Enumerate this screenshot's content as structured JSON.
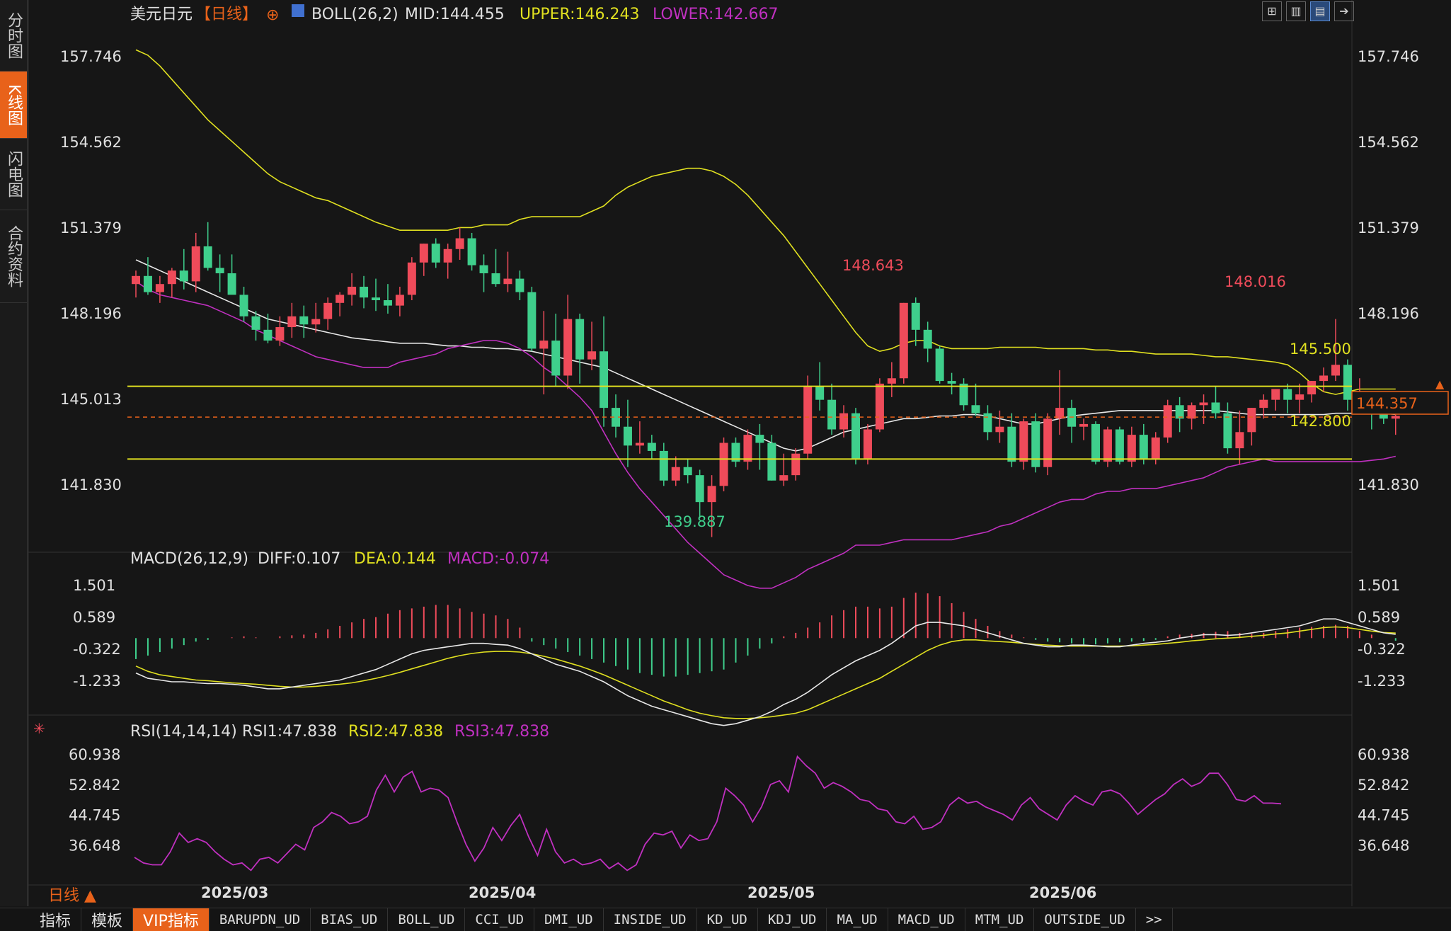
{
  "sidebar": {
    "items": [
      "分时图",
      "K线图",
      "闪电图",
      "合约资料"
    ],
    "active_index": 1
  },
  "header": {
    "symbol": "美元日元",
    "period": "【日线】",
    "boll_label": "BOLL(26,2)",
    "mid": "MID:144.455",
    "upper": "UPPER:146.243",
    "lower": "LOWER:142.667"
  },
  "toolbar_icons": [
    "grid-icon",
    "bar-chart-icon",
    "candle-chart-icon",
    "arrow-right-icon"
  ],
  "price_axis": {
    "ticks": [
      "157.746",
      "154.562",
      "151.379",
      "148.196",
      "145.013",
      "141.830"
    ],
    "current_price": "144.357",
    "current_price_value": 144.357
  },
  "annotations": {
    "high1": "148.643",
    "high2": "148.016",
    "low1": "139.887",
    "line_upper": "145.500",
    "line_lower": "142.800"
  },
  "macd": {
    "label": "MACD(26,12,9)",
    "diff": "DIFF:0.107",
    "dea": "DEA:0.144",
    "macd": "MACD:-0.074",
    "ticks": [
      "1.501",
      "0.589",
      "-0.322",
      "-1.233"
    ]
  },
  "rsi": {
    "label": "RSI(14,14,14)",
    "rsi1": "RSI1:47.838",
    "rsi2": "RSI2:47.838",
    "rsi3": "RSI3:47.838",
    "ticks": [
      "60.938",
      "52.842",
      "44.745",
      "36.648"
    ]
  },
  "date_labels": [
    "2025/03",
    "2025/04",
    "2025/05",
    "2025/06"
  ],
  "period_label": "日线 ▲",
  "bottom_tabs": [
    "指标",
    "模板",
    "VIP指标",
    "BARUPDN_UD",
    "BIAS_UD",
    "BOLL_UD",
    "CCI_UD",
    "DMI_UD",
    "INSIDE_UD",
    "KD_UD",
    "KDJ_UD",
    "MA_UD",
    "MACD_UD",
    "MTM_UD",
    "OUTSIDE_UD",
    ">>"
  ],
  "colors": {
    "up": "#ef4b5a",
    "down": "#3fcf8c",
    "mid": "#e8e8e8",
    "upper": "#e0e020",
    "lower": "#c030c0",
    "accent": "#e8621a"
  },
  "chart_data": {
    "type": "candlestick",
    "price_ylim": [
      139.6,
      158.8
    ],
    "macd_ylim": [
      -2.0,
      1.85
    ],
    "rsi_ylim": [
      28,
      64
    ],
    "ohlc": [
      [
        149.3,
        149.8,
        148.8,
        149.6
      ],
      [
        149.6,
        150.3,
        148.9,
        149.0
      ],
      [
        149.0,
        149.6,
        148.6,
        149.3
      ],
      [
        149.3,
        149.9,
        148.8,
        149.8
      ],
      [
        149.8,
        150.6,
        149.1,
        149.4
      ],
      [
        149.4,
        151.2,
        149.0,
        150.7
      ],
      [
        150.7,
        151.6,
        149.8,
        149.9
      ],
      [
        149.9,
        150.4,
        149.0,
        149.7
      ],
      [
        149.7,
        150.4,
        149.2,
        148.9
      ],
      [
        148.9,
        149.2,
        147.9,
        148.1
      ],
      [
        148.1,
        148.3,
        147.2,
        147.6
      ],
      [
        147.6,
        148.2,
        147.1,
        147.2
      ],
      [
        147.2,
        148.1,
        147.0,
        147.7
      ],
      [
        147.7,
        148.6,
        147.3,
        148.1
      ],
      [
        148.1,
        148.5,
        147.3,
        147.8
      ],
      [
        147.8,
        148.6,
        147.5,
        148.0
      ],
      [
        148.0,
        148.8,
        147.6,
        148.6
      ],
      [
        148.6,
        149.0,
        148.1,
        148.9
      ],
      [
        148.9,
        149.7,
        148.5,
        149.2
      ],
      [
        149.2,
        149.6,
        148.4,
        148.8
      ],
      [
        148.8,
        149.5,
        148.3,
        148.7
      ],
      [
        148.7,
        149.3,
        148.2,
        148.5
      ],
      [
        148.5,
        149.2,
        148.1,
        148.9
      ],
      [
        148.9,
        150.3,
        148.7,
        150.1
      ],
      [
        150.1,
        150.8,
        149.6,
        150.8
      ],
      [
        150.8,
        151.0,
        149.9,
        150.1
      ],
      [
        150.1,
        150.8,
        149.5,
        150.6
      ],
      [
        150.6,
        151.4,
        150.2,
        151.0
      ],
      [
        151.0,
        151.2,
        149.8,
        150.0
      ],
      [
        150.0,
        150.4,
        149.0,
        149.7
      ],
      [
        149.7,
        150.6,
        149.2,
        149.3
      ],
      [
        149.3,
        150.5,
        149.0,
        149.5
      ],
      [
        149.5,
        149.8,
        148.7,
        149.0
      ],
      [
        149.0,
        149.2,
        146.8,
        146.9
      ],
      [
        146.9,
        148.3,
        145.2,
        147.2
      ],
      [
        147.2,
        148.2,
        145.5,
        145.9
      ],
      [
        145.9,
        148.9,
        145.4,
        148.0
      ],
      [
        148.0,
        148.2,
        145.6,
        146.5
      ],
      [
        146.5,
        147.9,
        146.1,
        146.8
      ],
      [
        146.8,
        148.1,
        144.0,
        144.7
      ],
      [
        144.7,
        145.2,
        143.6,
        144.0
      ],
      [
        144.0,
        145.0,
        142.5,
        143.3
      ],
      [
        143.3,
        144.2,
        143.0,
        143.4
      ],
      [
        143.4,
        143.7,
        142.8,
        143.1
      ],
      [
        143.1,
        143.4,
        141.8,
        142.0
      ],
      [
        142.0,
        142.9,
        141.8,
        142.5
      ],
      [
        142.5,
        142.8,
        141.9,
        142.2
      ],
      [
        142.2,
        142.4,
        140.6,
        141.2
      ],
      [
        141.2,
        142.2,
        139.9,
        141.8
      ],
      [
        141.8,
        143.6,
        141.6,
        143.4
      ],
      [
        143.4,
        143.6,
        142.5,
        142.7
      ],
      [
        142.7,
        143.9,
        142.4,
        143.7
      ],
      [
        143.7,
        144.1,
        142.4,
        143.4
      ],
      [
        143.4,
        143.7,
        142.0,
        142.0
      ],
      [
        142.0,
        143.0,
        141.8,
        142.2
      ],
      [
        142.2,
        143.2,
        142.0,
        143.0
      ],
      [
        143.0,
        145.9,
        142.8,
        145.5
      ],
      [
        145.5,
        146.4,
        144.6,
        145.0
      ],
      [
        145.0,
        145.6,
        143.7,
        143.9
      ],
      [
        143.9,
        144.8,
        143.6,
        144.5
      ],
      [
        144.5,
        144.7,
        142.6,
        142.8
      ],
      [
        142.8,
        144.1,
        142.6,
        143.9
      ],
      [
        143.9,
        145.8,
        143.8,
        145.6
      ],
      [
        145.6,
        146.4,
        145.1,
        145.8
      ],
      [
        145.8,
        148.6,
        145.6,
        148.6
      ],
      [
        148.6,
        148.8,
        147.0,
        147.6
      ],
      [
        147.6,
        147.9,
        146.4,
        146.9
      ],
      [
        146.9,
        147.0,
        145.6,
        145.7
      ],
      [
        145.7,
        146.0,
        145.2,
        145.6
      ],
      [
        145.6,
        145.8,
        144.6,
        144.8
      ],
      [
        144.8,
        145.6,
        144.4,
        144.5
      ],
      [
        144.5,
        144.8,
        143.5,
        143.8
      ],
      [
        143.8,
        144.6,
        143.4,
        144.0
      ],
      [
        144.0,
        144.5,
        142.5,
        142.7
      ],
      [
        142.7,
        144.3,
        142.4,
        144.2
      ],
      [
        144.2,
        144.5,
        142.3,
        142.5
      ],
      [
        142.5,
        144.5,
        142.2,
        144.3
      ],
      [
        144.3,
        146.1,
        143.7,
        144.7
      ],
      [
        144.7,
        145.0,
        143.4,
        144.0
      ],
      [
        144.0,
        144.3,
        143.5,
        144.1
      ],
      [
        144.1,
        144.2,
        142.6,
        142.7
      ],
      [
        142.7,
        144.0,
        142.5,
        143.9
      ],
      [
        143.9,
        144.0,
        142.6,
        142.7
      ],
      [
        142.7,
        144.0,
        142.5,
        143.7
      ],
      [
        143.7,
        144.1,
        142.6,
        142.8
      ],
      [
        142.8,
        143.8,
        142.6,
        143.6
      ],
      [
        143.6,
        145.0,
        143.4,
        144.8
      ],
      [
        144.8,
        145.1,
        143.8,
        144.3
      ],
      [
        144.3,
        144.9,
        143.9,
        144.8
      ],
      [
        144.8,
        145.2,
        144.1,
        144.9
      ],
      [
        144.9,
        145.5,
        144.3,
        144.5
      ],
      [
        144.5,
        144.9,
        143.0,
        143.2
      ],
      [
        143.2,
        144.6,
        142.6,
        143.8
      ],
      [
        143.8,
        144.7,
        143.3,
        144.7
      ],
      [
        144.7,
        145.2,
        144.3,
        145.0
      ],
      [
        145.0,
        145.4,
        144.6,
        145.4
      ],
      [
        145.4,
        145.6,
        144.5,
        145.0
      ],
      [
        145.0,
        145.6,
        144.5,
        145.2
      ],
      [
        145.2,
        145.7,
        144.9,
        145.7
      ],
      [
        145.7,
        146.2,
        145.3,
        145.9
      ],
      [
        145.9,
        148.0,
        145.7,
        146.3
      ],
      [
        146.3,
        146.5,
        144.6,
        145.0
      ],
      [
        145.0,
        145.8,
        144.7,
        145.2
      ],
      [
        145.2,
        145.3,
        143.9,
        144.6
      ],
      [
        144.6,
        144.9,
        144.1,
        144.3
      ],
      [
        144.3,
        144.7,
        143.7,
        144.4
      ]
    ],
    "mid": [
      150.2,
      150.0,
      149.8,
      149.6,
      149.4,
      149.2,
      149.0,
      148.8,
      148.6,
      148.4,
      148.2,
      148.0,
      147.9,
      147.8,
      147.7,
      147.6,
      147.5,
      147.4,
      147.3,
      147.25,
      147.2,
      147.15,
      147.1,
      147.1,
      147.1,
      147.05,
      147.0,
      147.0,
      146.95,
      146.95,
      146.9,
      146.9,
      146.85,
      146.8,
      146.7,
      146.6,
      146.5,
      146.4,
      146.3,
      146.2,
      146.0,
      145.8,
      145.6,
      145.4,
      145.2,
      145.0,
      144.8,
      144.6,
      144.4,
      144.2,
      144.0,
      143.8,
      143.6,
      143.4,
      143.2,
      143.1,
      143.2,
      143.4,
      143.6,
      143.8,
      143.9,
      144.0,
      144.1,
      144.2,
      144.3,
      144.3,
      144.35,
      144.4,
      144.4,
      144.45,
      144.45,
      144.4,
      144.3,
      144.2,
      144.1,
      144.1,
      144.2,
      144.3,
      144.4,
      144.45,
      144.5,
      144.55,
      144.6,
      144.6,
      144.6,
      144.6,
      144.6,
      144.6,
      144.6,
      144.6,
      144.6,
      144.55,
      144.5,
      144.45,
      144.45,
      144.45,
      144.45,
      144.45,
      144.45,
      144.45,
      144.5,
      144.5,
      144.5,
      144.5,
      144.5,
      144.455
    ],
    "upper": [
      158.0,
      157.8,
      157.4,
      156.9,
      156.4,
      155.9,
      155.4,
      155.0,
      154.6,
      154.2,
      153.8,
      153.4,
      153.1,
      152.9,
      152.7,
      152.5,
      152.4,
      152.2,
      152.0,
      151.8,
      151.6,
      151.45,
      151.3,
      151.3,
      151.3,
      151.3,
      151.3,
      151.4,
      151.4,
      151.5,
      151.5,
      151.5,
      151.7,
      151.8,
      151.8,
      151.8,
      151.8,
      151.8,
      152.0,
      152.2,
      152.6,
      152.9,
      153.1,
      153.3,
      153.4,
      153.5,
      153.6,
      153.6,
      153.5,
      153.3,
      153.0,
      152.6,
      152.1,
      151.6,
      151.1,
      150.5,
      149.9,
      149.3,
      148.7,
      148.1,
      147.5,
      147.0,
      146.8,
      146.9,
      147.1,
      147.2,
      147.2,
      147.0,
      146.9,
      146.9,
      146.9,
      146.9,
      146.95,
      146.95,
      146.95,
      146.95,
      146.9,
      146.9,
      146.9,
      146.9,
      146.85,
      146.85,
      146.8,
      146.8,
      146.75,
      146.7,
      146.7,
      146.7,
      146.7,
      146.65,
      146.6,
      146.6,
      146.55,
      146.5,
      146.45,
      146.4,
      146.3,
      146.0,
      145.6,
      145.3,
      145.2,
      145.3,
      145.4,
      145.4,
      145.4,
      145.4
    ],
    "lower": [
      149.4,
      149.1,
      148.9,
      148.8,
      148.7,
      148.6,
      148.5,
      148.3,
      148.1,
      147.9,
      147.6,
      147.4,
      147.2,
      147.0,
      146.8,
      146.6,
      146.5,
      146.4,
      146.3,
      146.2,
      146.2,
      146.2,
      146.4,
      146.5,
      146.6,
      146.7,
      146.9,
      147.0,
      147.1,
      147.2,
      147.2,
      147.1,
      146.9,
      146.6,
      146.2,
      145.9,
      145.5,
      145.1,
      144.6,
      143.8,
      143.0,
      142.3,
      141.7,
      141.2,
      140.7,
      140.2,
      139.7,
      139.3,
      138.9,
      138.5,
      138.3,
      138.1,
      138.0,
      138.0,
      138.2,
      138.4,
      138.7,
      138.9,
      139.1,
      139.3,
      139.6,
      139.6,
      139.6,
      139.7,
      139.8,
      139.8,
      139.8,
      139.8,
      139.8,
      139.9,
      140.0,
      140.1,
      140.3,
      140.4,
      140.6,
      140.8,
      141.0,
      141.2,
      141.3,
      141.3,
      141.5,
      141.6,
      141.6,
      141.7,
      141.7,
      141.7,
      141.8,
      141.9,
      142.0,
      142.1,
      142.3,
      142.5,
      142.6,
      142.7,
      142.8,
      142.7,
      142.7,
      142.7,
      142.7,
      142.7,
      142.7,
      142.7,
      142.7,
      142.75,
      142.8,
      142.9
    ],
    "macd_hist": [
      -0.6,
      -0.5,
      -0.4,
      -0.3,
      -0.2,
      -0.1,
      -0.05,
      0,
      0.02,
      0.05,
      0.02,
      0,
      0.05,
      0.08,
      0.1,
      0.15,
      0.25,
      0.35,
      0.45,
      0.55,
      0.6,
      0.7,
      0.8,
      0.85,
      0.9,
      0.95,
      0.95,
      0.85,
      0.75,
      0.7,
      0.65,
      0.55,
      0.3,
      -0.1,
      -0.2,
      -0.3,
      -0.4,
      -0.5,
      -0.6,
      -0.7,
      -0.8,
      -0.9,
      -1.0,
      -1.05,
      -1.1,
      -1.1,
      -1.05,
      -1.0,
      -0.95,
      -0.9,
      -0.7,
      -0.5,
      -0.3,
      -0.15,
      0.05,
      0.15,
      0.3,
      0.45,
      0.65,
      0.8,
      0.9,
      0.9,
      0.85,
      0.9,
      1.15,
      1.3,
      1.28,
      1.2,
      1.0,
      0.75,
      0.55,
      0.35,
      0.2,
      0.1,
      0.02,
      -0.05,
      -0.1,
      -0.12,
      -0.15,
      -0.18,
      -0.18,
      -0.15,
      -0.12,
      -0.1,
      -0.08,
      -0.05,
      0.05,
      0.1,
      0.12,
      0.15,
      0.18,
      0.2,
      0.15,
      0.12,
      0.15,
      0.2,
      0.25,
      0.3,
      0.32,
      0.35,
      0.38,
      0.35,
      0.2,
      0.1,
      0.0,
      -0.074
    ],
    "macd_diff": [
      -1.0,
      -1.15,
      -1.2,
      -1.25,
      -1.25,
      -1.28,
      -1.3,
      -1.3,
      -1.32,
      -1.35,
      -1.4,
      -1.45,
      -1.45,
      -1.4,
      -1.35,
      -1.3,
      -1.25,
      -1.2,
      -1.1,
      -1.0,
      -0.9,
      -0.75,
      -0.6,
      -0.45,
      -0.35,
      -0.3,
      -0.25,
      -0.2,
      -0.15,
      -0.15,
      -0.18,
      -0.2,
      -0.3,
      -0.45,
      -0.6,
      -0.75,
      -0.85,
      -0.95,
      -1.1,
      -1.25,
      -1.45,
      -1.65,
      -1.8,
      -1.95,
      -2.05,
      -2.15,
      -2.25,
      -2.35,
      -2.45,
      -2.5,
      -2.45,
      -2.35,
      -2.25,
      -2.1,
      -1.9,
      -1.75,
      -1.55,
      -1.3,
      -1.05,
      -0.85,
      -0.65,
      -0.5,
      -0.35,
      -0.15,
      0.1,
      0.35,
      0.45,
      0.45,
      0.4,
      0.35,
      0.25,
      0.15,
      0.05,
      -0.05,
      -0.15,
      -0.2,
      -0.25,
      -0.25,
      -0.2,
      -0.2,
      -0.22,
      -0.25,
      -0.25,
      -0.2,
      -0.15,
      -0.12,
      -0.08,
      0.0,
      0.05,
      0.1,
      0.1,
      0.08,
      0.1,
      0.15,
      0.2,
      0.25,
      0.3,
      0.35,
      0.45,
      0.55,
      0.55,
      0.45,
      0.35,
      0.25,
      0.15,
      0.107
    ],
    "macd_dea": [
      -0.8,
      -0.95,
      -1.05,
      -1.1,
      -1.15,
      -1.2,
      -1.22,
      -1.25,
      -1.28,
      -1.3,
      -1.32,
      -1.35,
      -1.38,
      -1.4,
      -1.4,
      -1.38,
      -1.35,
      -1.32,
      -1.28,
      -1.22,
      -1.15,
      -1.07,
      -0.98,
      -0.88,
      -0.78,
      -0.68,
      -0.58,
      -0.5,
      -0.44,
      -0.4,
      -0.38,
      -0.38,
      -0.4,
      -0.45,
      -0.52,
      -0.6,
      -0.7,
      -0.8,
      -0.92,
      -1.05,
      -1.2,
      -1.35,
      -1.5,
      -1.65,
      -1.8,
      -1.92,
      -2.05,
      -2.15,
      -2.22,
      -2.28,
      -2.3,
      -2.3,
      -2.28,
      -2.25,
      -2.2,
      -2.15,
      -2.05,
      -1.9,
      -1.75,
      -1.6,
      -1.45,
      -1.3,
      -1.15,
      -0.95,
      -0.75,
      -0.55,
      -0.35,
      -0.2,
      -0.1,
      -0.05,
      -0.05,
      -0.08,
      -0.1,
      -0.12,
      -0.15,
      -0.18,
      -0.2,
      -0.22,
      -0.23,
      -0.23,
      -0.23,
      -0.23,
      -0.23,
      -0.22,
      -0.2,
      -0.18,
      -0.15,
      -0.12,
      -0.08,
      -0.05,
      -0.02,
      0.0,
      0.02,
      0.05,
      0.08,
      0.12,
      0.15,
      0.2,
      0.25,
      0.3,
      0.32,
      0.3,
      0.25,
      0.2,
      0.16,
      0.144
    ],
    "rsi": [
      33.5,
      32,
      31.5,
      31.5,
      35,
      40,
      37.5,
      38.5,
      37.5,
      35,
      33,
      31.5,
      32,
      30,
      33,
      33.5,
      32,
      34.5,
      37,
      35.5,
      41.5,
      43,
      45.5,
      44.5,
      42.5,
      43,
      44.5,
      51.5,
      55.5,
      51,
      55,
      56.5,
      51,
      52,
      51.5,
      49.5,
      43,
      37,
      32.5,
      36,
      41.5,
      38,
      42,
      45,
      39,
      34,
      41,
      35,
      32,
      33,
      31.5,
      32,
      33,
      30.5,
      32,
      30,
      31.5,
      37,
      40,
      39.5,
      40.5,
      36,
      39.5,
      38,
      38.5,
      43,
      52,
      50,
      47.5,
      43,
      47,
      53,
      54,
      51,
      60.5,
      58,
      56,
      52,
      53.5,
      52.5,
      51,
      49,
      48.5,
      46.5,
      46,
      43,
      42.5,
      44.5,
      41,
      41.5,
      43,
      47.5,
      49.5,
      48,
      48.5,
      47,
      46,
      45,
      43.5,
      47.5,
      49.5,
      46.5,
      45,
      43.5,
      47.5,
      50,
      48.5,
      47.5,
      51,
      51.5,
      50.5,
      48,
      45,
      47,
      49,
      50.5,
      53,
      54.5,
      52.5,
      53.5,
      56,
      56,
      53,
      49,
      48.5,
      50,
      48,
      48,
      47.838
    ]
  }
}
